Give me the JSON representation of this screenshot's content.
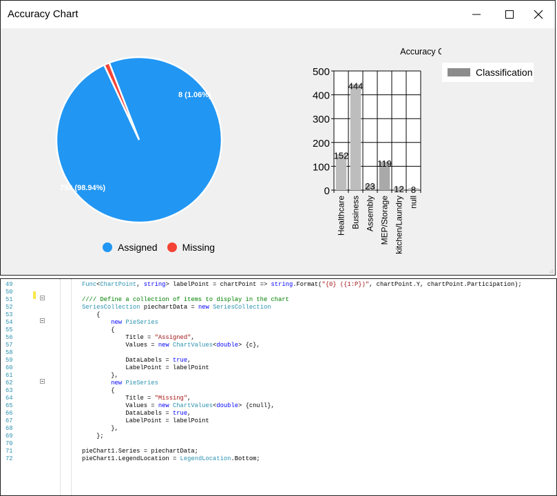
{
  "window": {
    "title": "Accuracy Chart",
    "controls": [
      "minimize",
      "maximize",
      "close"
    ]
  },
  "colors": {
    "assigned": "#2196f3",
    "missing": "#f44336",
    "bar": "#bdbdbd",
    "bar_dark": "#a9a9a9",
    "legend_swatch": "#8c8c8c"
  },
  "pie_legend": {
    "items": [
      {
        "label": "Assigned",
        "color": "#2196f3"
      },
      {
        "label": "Missing",
        "color": "#f44336"
      }
    ]
  },
  "bar_legend": {
    "label": "Classification"
  },
  "chart_data": [
    {
      "type": "pie",
      "labels": [
        "Assigned",
        "Missing"
      ],
      "values": [
        750,
        8
      ],
      "data_labels": [
        "750 (98.94%)",
        "8 (1.06%)"
      ],
      "legend_position": "bottom"
    },
    {
      "type": "bar",
      "title": "Accuracy Chart",
      "categories": [
        "Healthcare",
        "Business",
        "Assembly",
        "MEP/Storage",
        "kitchen/Laundry",
        "null"
      ],
      "series": [
        {
          "name": "Classification",
          "values": [
            152,
            444,
            23,
            119,
            12,
            8
          ]
        }
      ],
      "ylim": [
        0,
        500
      ],
      "yticks": [
        "0",
        "100",
        "200",
        "300",
        "400",
        "500"
      ],
      "grid": true,
      "legend_position": "top-right"
    }
  ],
  "code": {
    "lines": [
      {
        "n": "49",
        "segs": [
          [
            "ty",
            "Func"
          ],
          [
            "",
            "<"
          ],
          [
            "ty",
            "ChartPoint"
          ],
          [
            "",
            ", "
          ],
          [
            "kw",
            "string"
          ],
          [
            "",
            "> labelPoint = chartPoint => "
          ],
          [
            "kw",
            "string"
          ],
          [
            "",
            ".Format("
          ],
          [
            "str",
            "\"{0} ({1:P})\""
          ],
          [
            "",
            ", chartPoint.Y, chartPoint.Participation);"
          ]
        ]
      },
      {
        "n": "50",
        "segs": []
      },
      {
        "n": "51",
        "segs": [
          [
            "cm",
            "//// Define a collection of items to display in the chart"
          ]
        ]
      },
      {
        "n": "52",
        "segs": [
          [
            "ty",
            "SeriesCollection"
          ],
          [
            "",
            " piechartData = "
          ],
          [
            "kw",
            "new"
          ],
          [
            "",
            " "
          ],
          [
            "ty",
            "SeriesCollection"
          ]
        ]
      },
      {
        "n": "53",
        "segs": [
          [
            "",
            "    {"
          ]
        ]
      },
      {
        "n": "54",
        "segs": [
          [
            "",
            "        "
          ],
          [
            "kw",
            "new"
          ],
          [
            "",
            " "
          ],
          [
            "ty",
            "PieSeries"
          ]
        ]
      },
      {
        "n": "55",
        "segs": [
          [
            "",
            "        {"
          ]
        ]
      },
      {
        "n": "56",
        "segs": [
          [
            "",
            "            Title = "
          ],
          [
            "str",
            "\"Assigned\""
          ],
          [
            "",
            ","
          ]
        ]
      },
      {
        "n": "57",
        "segs": [
          [
            "",
            "            Values = "
          ],
          [
            "kw",
            "new"
          ],
          [
            "",
            " "
          ],
          [
            "ty",
            "ChartValues"
          ],
          [
            "",
            "<"
          ],
          [
            "kw",
            "double"
          ],
          [
            "",
            "> {c},"
          ]
        ]
      },
      {
        "n": "58",
        "segs": []
      },
      {
        "n": "59",
        "segs": [
          [
            "",
            "            DataLabels = "
          ],
          [
            "kw",
            "true"
          ],
          [
            "",
            ","
          ]
        ]
      },
      {
        "n": "60",
        "segs": [
          [
            "",
            "            LabelPoint = labelPoint"
          ]
        ]
      },
      {
        "n": "61",
        "segs": [
          [
            "",
            "        },"
          ]
        ]
      },
      {
        "n": "62",
        "segs": [
          [
            "",
            "        "
          ],
          [
            "kw",
            "new"
          ],
          [
            "",
            " "
          ],
          [
            "ty",
            "PieSeries"
          ]
        ]
      },
      {
        "n": "63",
        "segs": [
          [
            "",
            "        {"
          ]
        ]
      },
      {
        "n": "64",
        "segs": [
          [
            "",
            "            Title = "
          ],
          [
            "str",
            "\"Missing\""
          ],
          [
            "",
            ","
          ]
        ]
      },
      {
        "n": "65",
        "segs": [
          [
            "",
            "            Values = "
          ],
          [
            "kw",
            "new"
          ],
          [
            "",
            " "
          ],
          [
            "ty",
            "ChartValues"
          ],
          [
            "",
            "<"
          ],
          [
            "kw",
            "double"
          ],
          [
            "",
            "> {cnull},"
          ]
        ]
      },
      {
        "n": "66",
        "segs": [
          [
            "",
            "            DataLabels = "
          ],
          [
            "kw",
            "true"
          ],
          [
            "",
            ","
          ]
        ]
      },
      {
        "n": "67",
        "segs": [
          [
            "",
            "            LabelPoint = labelPoint"
          ]
        ]
      },
      {
        "n": "68",
        "segs": [
          [
            "",
            "        },"
          ]
        ]
      },
      {
        "n": "69",
        "segs": [
          [
            "",
            "    };"
          ]
        ]
      },
      {
        "n": "70",
        "segs": []
      },
      {
        "n": "71",
        "segs": [
          [
            "",
            "pieChart1.Series = piechartData;"
          ]
        ]
      },
      {
        "n": "72",
        "segs": [
          [
            "",
            "pieChart1.LegendLocation = "
          ],
          [
            "ty",
            "LegendLocation"
          ],
          [
            "",
            ".Bottom;"
          ]
        ]
      }
    ]
  }
}
